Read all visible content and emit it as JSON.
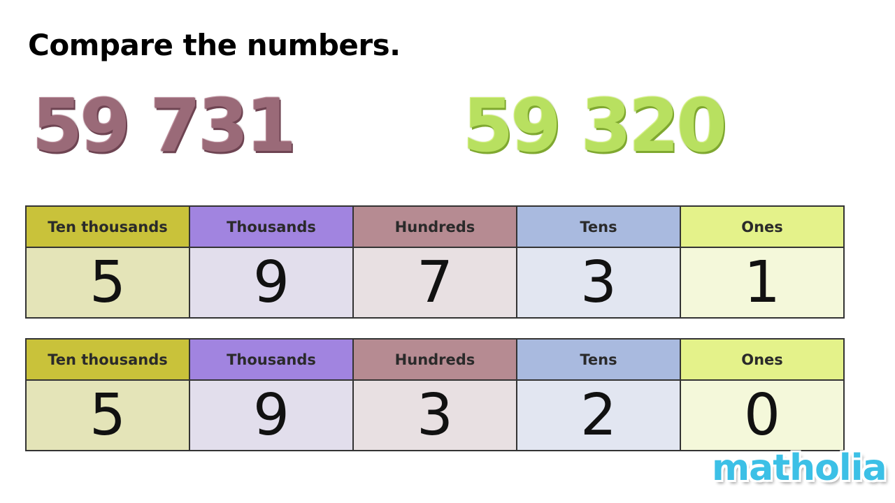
{
  "title": "Compare the numbers.",
  "numbers": {
    "first": "59 731",
    "second": "59 320"
  },
  "colors": {
    "first_number": "#9a6a78",
    "second_number": "#b8e060",
    "logo": "#3cc0e6"
  },
  "headers": [
    "Ten thousands",
    "Thousands",
    "Hundreds",
    "Tens",
    "Ones"
  ],
  "tables": [
    {
      "digits": [
        "5",
        "9",
        "7",
        "3",
        "1"
      ]
    },
    {
      "digits": [
        "5",
        "9",
        "3",
        "2",
        "0"
      ]
    }
  ],
  "logo": "matholia"
}
